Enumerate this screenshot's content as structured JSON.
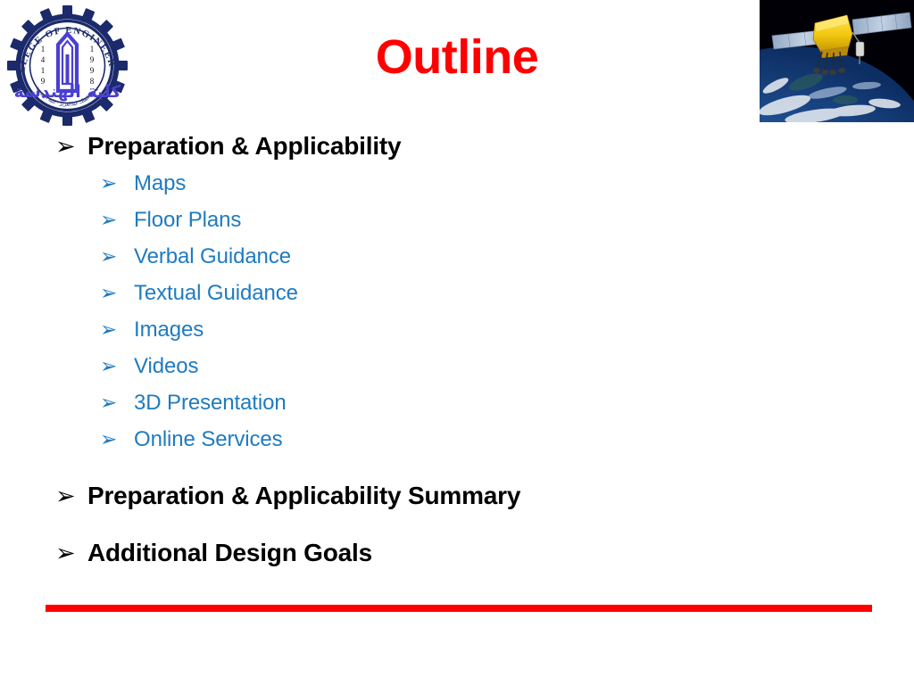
{
  "slide": {
    "title": "Outline",
    "title_color": "#FF0000",
    "background_color": "#FFFFFF"
  },
  "logo": {
    "name": "college-of-engineering-seal",
    "arc_text": "COLLEGE OF ENGINEERING",
    "year_hijri": "1419",
    "year_gregorian": "1998",
    "arabic_main": "كلية الهندسة",
    "arabic_sub": "جامعة الملك عبدالعزيز",
    "ring_color": "#1B2A6B",
    "tower_color": "#4A3FD4"
  },
  "satellite_image": {
    "name": "gps-satellite-over-earth",
    "description": "GPS satellite with gold body and solar panels orbiting above Earth",
    "space_color": "#000008",
    "earth_color": "#1D4F96",
    "panel_color": "#A8BCD8",
    "body_color": "#F2CE18"
  },
  "bullets": [
    {
      "level": 1,
      "marker": "➢",
      "label": "Preparation & Applicability",
      "color": "#000000",
      "gap_before": false
    },
    {
      "level": 2,
      "marker": "➢",
      "label": "Maps",
      "color": "#1F7BBF",
      "gap_before": false
    },
    {
      "level": 2,
      "marker": "➢",
      "label": "Floor Plans",
      "color": "#1F7BBF",
      "gap_before": false
    },
    {
      "level": 2,
      "marker": "➢",
      "label": "Verbal Guidance",
      "color": "#1F7BBF",
      "gap_before": false
    },
    {
      "level": 2,
      "marker": "➢",
      "label": "Textual Guidance",
      "color": "#1F7BBF",
      "gap_before": false
    },
    {
      "level": 2,
      "marker": "➢",
      "label": "Images",
      "color": "#1F7BBF",
      "gap_before": false
    },
    {
      "level": 2,
      "marker": "➢",
      "label": "Videos",
      "color": "#1F7BBF",
      "gap_before": false
    },
    {
      "level": 2,
      "marker": "➢",
      "label": "3D Presentation",
      "color": "#1F7BBF",
      "gap_before": false
    },
    {
      "level": 2,
      "marker": "➢",
      "label": "Online Services",
      "color": "#1F7BBF",
      "gap_before": false
    },
    {
      "level": 1,
      "marker": "➢",
      "label": "Preparation & Applicability Summary",
      "color": "#000000",
      "gap_before": true
    },
    {
      "level": 1,
      "marker": "➢",
      "label": "Additional Design Goals",
      "color": "#000000",
      "gap_before": true
    }
  ],
  "divider": {
    "name": "bottom-red-rule",
    "color": "#FF0000"
  }
}
